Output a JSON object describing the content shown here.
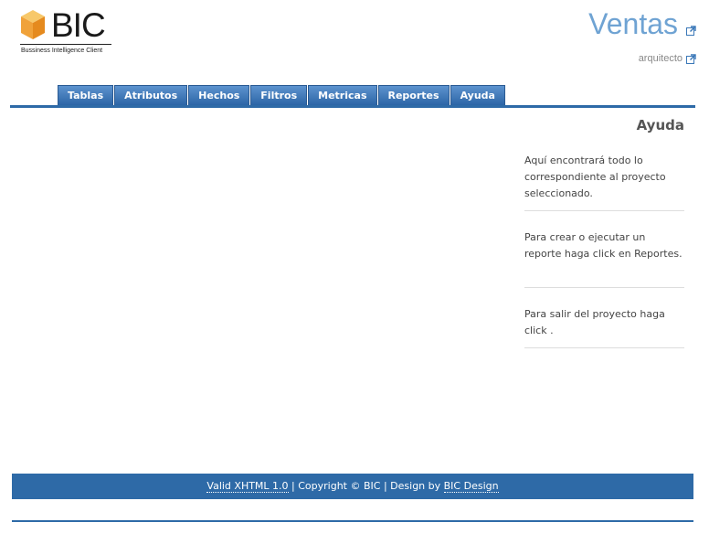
{
  "logo": {
    "text": "BIC",
    "subtitle": "Bussiness Intelligence Client",
    "cube_colors": {
      "top": "#f7c86a",
      "left": "#f0a23a",
      "right": "#e58a1e"
    }
  },
  "header": {
    "project_title": "Ventas",
    "user": "arquitecto",
    "external_icon": "external-link-icon"
  },
  "nav": {
    "tabs": [
      "Tablas",
      "Atributos",
      "Hechos",
      "Filtros",
      "Metricas",
      "Reportes",
      "Ayuda"
    ]
  },
  "sidebar": {
    "title": "Ayuda",
    "sections": [
      "Aquí encontrará todo lo correspondiente al proyecto seleccionado.",
      "Para crear o ejecutar un reporte haga click en Reportes.",
      "Para salir del proyecto haga click ."
    ]
  },
  "footer": {
    "valid_link": "Valid XHTML 1.0",
    "sep1": " | ",
    "copyright": "Copyright © BIC",
    "sep2": " | ",
    "design_prefix": "Design by ",
    "design_link": "BIC Design"
  },
  "colors": {
    "accent": "#2e6aa7",
    "title": "#6fa3d3",
    "tab_top": "#5d93cf",
    "tab_bottom": "#2c65a6"
  }
}
